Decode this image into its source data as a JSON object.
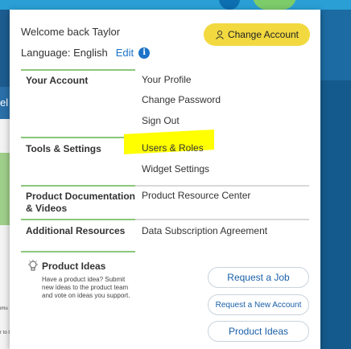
{
  "header": {
    "welcome": "Welcome back Taylor",
    "change_account": "Change Account",
    "language_label": "Language: English",
    "edit": "Edit"
  },
  "sections": [
    {
      "category": "Your Account",
      "links": [
        "Your Profile",
        "Change Password",
        "Sign Out"
      ]
    },
    {
      "category": "Tools & Settings",
      "links": [
        "Users & Roles",
        "Widget Settings"
      ]
    },
    {
      "category": "Product Documentation & Videos",
      "links": [
        "Product Resource Center"
      ]
    },
    {
      "category": "Additional Resources",
      "links": [
        "Data Subscription Agreement"
      ]
    }
  ],
  "ideas": {
    "title": "Product Ideas",
    "description": "Have a product idea? Submit new ideas to the product team and vote on ideas you support."
  },
  "actions": [
    "Request a Job",
    "Request a New Account",
    "Product Ideas"
  ],
  "background": {
    "left_text": "el",
    "fragment_1": "imu",
    "fragment_2": "r to t"
  },
  "colors": {
    "accent_yellow": "#f2d940",
    "link_blue": "#1a73c9",
    "divider_green": "#8cc77a",
    "highlight": "#ffff00"
  }
}
